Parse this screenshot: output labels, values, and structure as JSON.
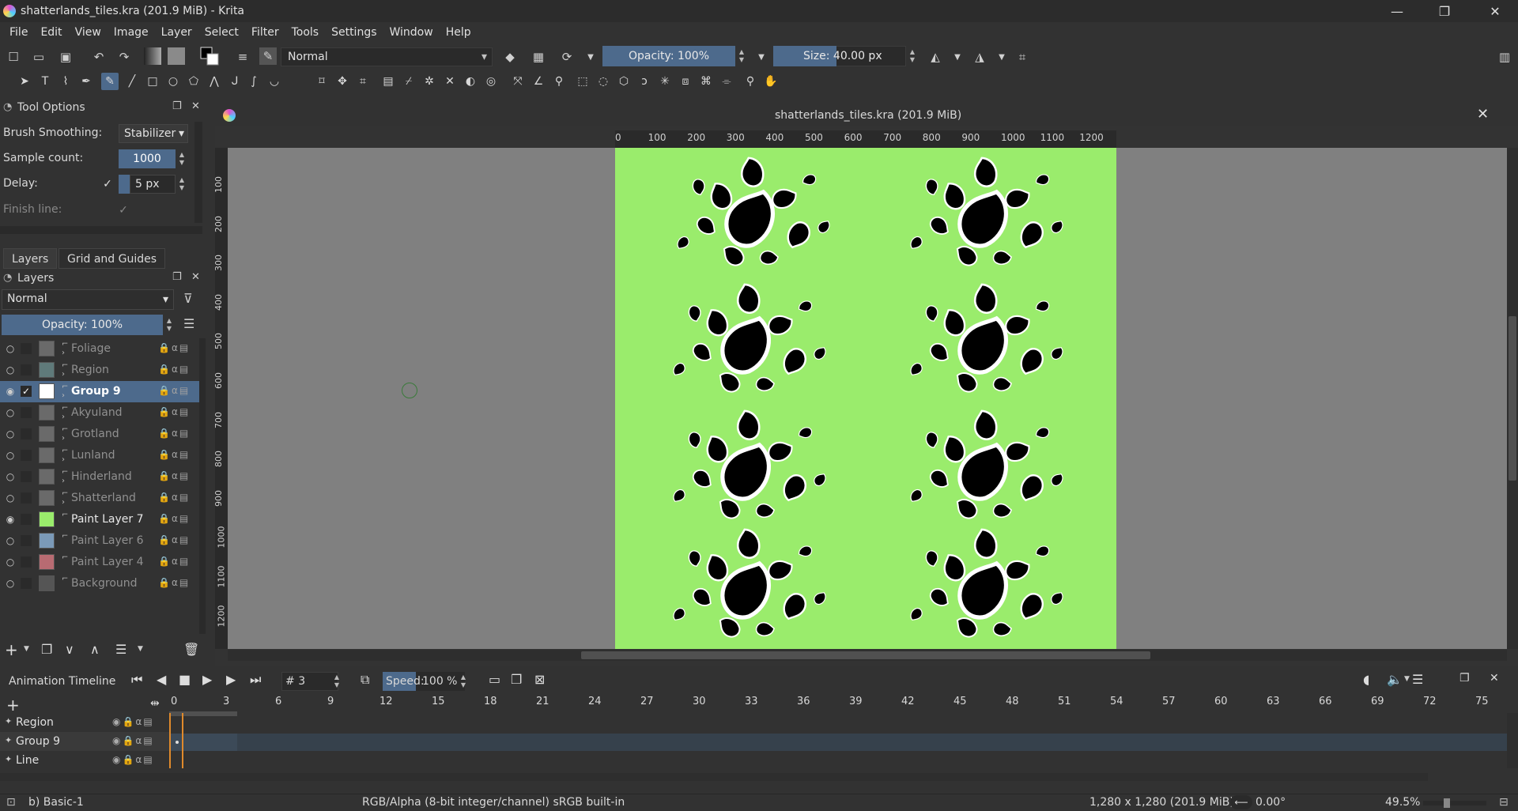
{
  "window": {
    "title": "shatterlands_tiles.kra (201.9 MiB)  - Krita",
    "minimize": "—",
    "maximize": "❐",
    "close": "✕"
  },
  "menu": [
    "File",
    "Edit",
    "View",
    "Image",
    "Layer",
    "Select",
    "Filter",
    "Tools",
    "Settings",
    "Window",
    "Help"
  ],
  "toolbar": {
    "blend_mode": "Normal",
    "opacity": "Opacity: 100%",
    "size": "Size: 40.00 px"
  },
  "tool_options": {
    "title": "Tool Options",
    "brush_smoothing_label": "Brush Smoothing:",
    "brush_smoothing_value": "Stabilizer",
    "sample_count_label": "Sample count:",
    "sample_count_value": "1000",
    "delay_label": "Delay:",
    "delay_value": "5 px",
    "finish_line_label": "Finish line:"
  },
  "docker_tabs": [
    "Layers",
    "Grid and Guides"
  ],
  "layers_panel": {
    "title": "Layers",
    "blend_mode": "Normal",
    "opacity": "Opacity:  100%",
    "layers": [
      {
        "name": "Foliage",
        "visible": false,
        "group": true,
        "selected": false,
        "thumb": "#6a6a6a"
      },
      {
        "name": "Region",
        "visible": false,
        "group": true,
        "selected": false,
        "thumb": "#5f7a7a"
      },
      {
        "name": "Group 9",
        "visible": true,
        "group": true,
        "selected": true,
        "thumb": "#ffffff"
      },
      {
        "name": "Akyuland",
        "visible": false,
        "group": true,
        "selected": false,
        "thumb": "#6a6a6a"
      },
      {
        "name": "Grotland",
        "visible": false,
        "group": true,
        "selected": false,
        "thumb": "#6a6a6a"
      },
      {
        "name": "Lunland",
        "visible": false,
        "group": true,
        "selected": false,
        "thumb": "#6a6a6a"
      },
      {
        "name": "Hinderland",
        "visible": false,
        "group": true,
        "selected": false,
        "thumb": "#6a6a6a"
      },
      {
        "name": "Shatterland",
        "visible": false,
        "group": true,
        "selected": false,
        "thumb": "#6a6a6a"
      },
      {
        "name": "Paint Layer 7",
        "visible": true,
        "group": false,
        "selected": false,
        "thumb": "#9aec6c"
      },
      {
        "name": "Paint Layer 6",
        "visible": false,
        "group": false,
        "selected": false,
        "thumb": "#7b9ab8"
      },
      {
        "name": "Paint Layer 4",
        "visible": false,
        "group": false,
        "selected": false,
        "thumb": "#b86b72"
      },
      {
        "name": "Background",
        "visible": false,
        "group": false,
        "selected": false,
        "thumb": "#555555"
      }
    ]
  },
  "canvas": {
    "title": "shatterlands_tiles.kra (201.9 MiB)",
    "ruler_top": [
      "0",
      "100",
      "200",
      "300",
      "400",
      "500",
      "600",
      "700",
      "800",
      "900",
      "1000",
      "1100",
      "1200"
    ],
    "ruler_left": [
      "100",
      "200",
      "300",
      "400",
      "500",
      "600",
      "700",
      "800",
      "900",
      "1000",
      "1100",
      "1200"
    ],
    "background_color": "#808080",
    "artboard_color": "#9aec6c"
  },
  "timeline": {
    "title": "Animation Timeline",
    "frame": "3",
    "speed_label": "Speed:",
    "speed_value": "100 %",
    "frame_numbers": [
      "0",
      "3",
      "6",
      "9",
      "12",
      "15",
      "18",
      "21",
      "24",
      "27",
      "30",
      "33",
      "36",
      "39",
      "42",
      "45",
      "48",
      "51",
      "54",
      "57",
      "60",
      "63",
      "66",
      "69",
      "72",
      "75"
    ],
    "rows": [
      "Region",
      "Group 9",
      "Line"
    ]
  },
  "status": {
    "brush": "b) Basic-1",
    "color_space": "RGB/Alpha (8-bit integer/channel)  sRGB built-in",
    "image_size": "1,280 x 1,280 (201.9 MiB)",
    "rotation": "0.00°",
    "zoom": "49.5%"
  }
}
